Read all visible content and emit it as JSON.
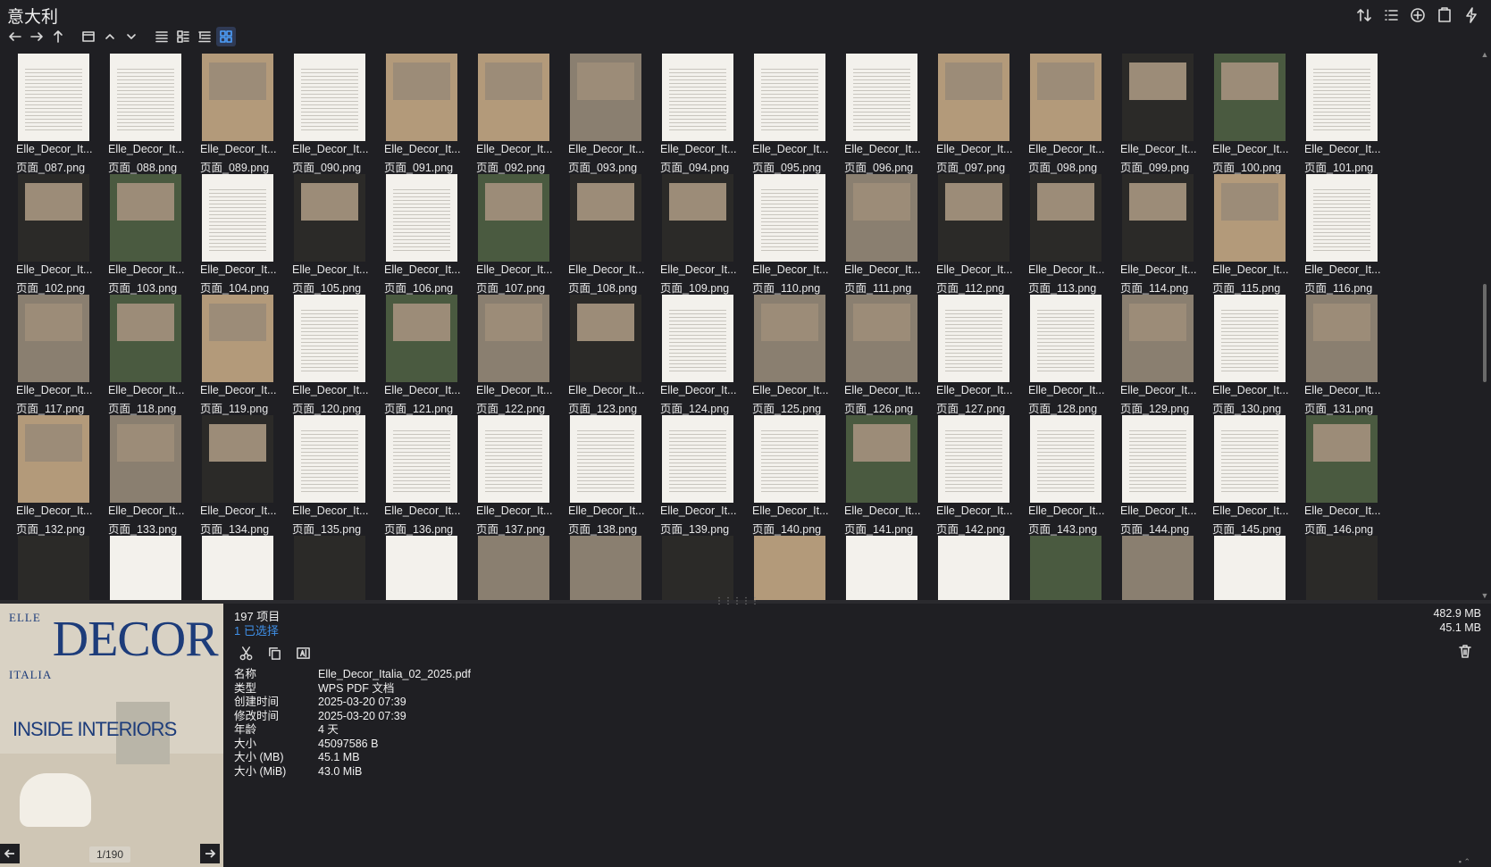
{
  "window": {
    "title": "意大利"
  },
  "toolbar": {
    "top_icons": [
      "sort-icon",
      "list-details-icon",
      "add-circle-icon",
      "clipboard-icon",
      "flash-icon"
    ],
    "nav_icons": [
      "back-arrow-icon",
      "forward-arrow-icon",
      "up-arrow-icon",
      "folder-icon",
      "chevron-up-icon",
      "chevron-down-icon",
      "view-list-icon",
      "view-details-icon",
      "view-tree-icon",
      "view-grid-icon"
    ],
    "active_view": "view-grid-icon"
  },
  "files": {
    "name_prefix": "Elle_Decor_It...",
    "items": [
      "页面_087.png",
      "页面_088.png",
      "页面_089.png",
      "页面_090.png",
      "页面_091.png",
      "页面_092.png",
      "页面_093.png",
      "页面_094.png",
      "页面_095.png",
      "页面_096.png",
      "页面_097.png",
      "页面_098.png",
      "页面_099.png",
      "页面_100.png",
      "页面_101.png",
      "页面_102.png",
      "页面_103.png",
      "页面_104.png",
      "页面_105.png",
      "页面_106.png",
      "页面_107.png",
      "页面_108.png",
      "页面_109.png",
      "页面_110.png",
      "页面_111.png",
      "页面_112.png",
      "页面_113.png",
      "页面_114.png",
      "页面_115.png",
      "页面_116.png",
      "页面_117.png",
      "页面_118.png",
      "页面_119.png",
      "页面_120.png",
      "页面_121.png",
      "页面_122.png",
      "页面_123.png",
      "页面_124.png",
      "页面_125.png",
      "页面_126.png",
      "页面_127.png",
      "页面_128.png",
      "页面_129.png",
      "页面_130.png",
      "页面_131.png",
      "页面_132.png",
      "页面_133.png",
      "页面_134.png",
      "页面_135.png",
      "页面_136.png",
      "页面_137.png",
      "页面_138.png",
      "页面_139.png",
      "页面_140.png",
      "页面_141.png",
      "页面_142.png",
      "页面_143.png",
      "页面_144.png",
      "页面_145.png",
      "页面_146.png"
    ],
    "partial_row_count": 15
  },
  "status": {
    "item_count": "197 项目",
    "selected": "1 已选择",
    "total_size": "482.9 MB",
    "selected_size": "45.1 MB"
  },
  "preview": {
    "logo": "DECOR",
    "logo_small": "ELLE",
    "edition": "ITALIA",
    "headline": "INSIDE INTERIORS",
    "page_indicator": "1/190"
  },
  "properties": [
    {
      "key": "名称",
      "value": "Elle_Decor_Italia_02_2025.pdf"
    },
    {
      "key": "类型",
      "value": "WPS PDF 文档"
    },
    {
      "key": "创建时间",
      "value": "2025-03-20  07:39"
    },
    {
      "key": "修改时间",
      "value": "2025-03-20  07:39"
    },
    {
      "key": "年龄",
      "value": "4 天"
    },
    {
      "key": "大小",
      "value": "45097586 B"
    },
    {
      "key": "大小 (MB)",
      "value": "45.1 MB"
    },
    {
      "key": "大小 (MiB)",
      "value": "43.0 MiB"
    }
  ]
}
